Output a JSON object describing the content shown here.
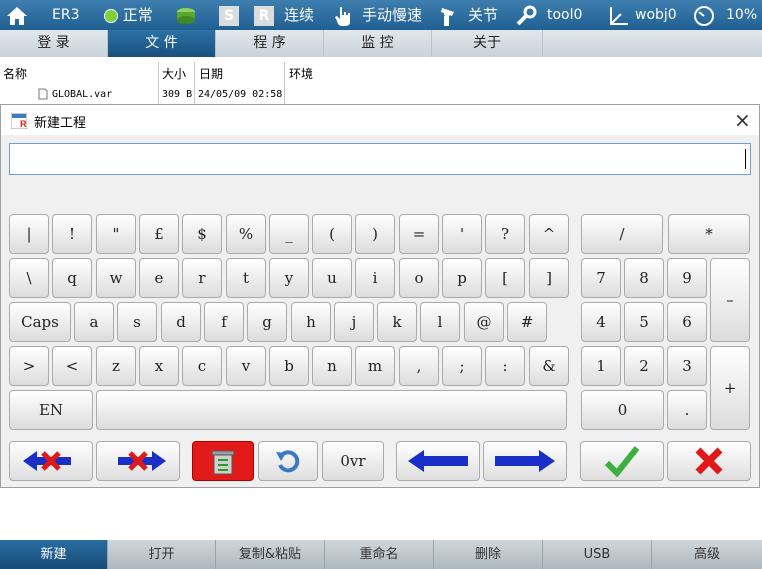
{
  "status_bar": {
    "robot": "ER3",
    "state": "正常",
    "mode_s": "S",
    "mode_r": "R",
    "run_mode": "连续",
    "speed_mode": "手动慢速",
    "coord": "关节",
    "tool": "tool0",
    "wobj": "wobj0",
    "speed_pct": "10%"
  },
  "tabs": [
    "登 录",
    "文 件",
    "程 序",
    "监 控",
    "关于"
  ],
  "file_list": {
    "headers": [
      "名称",
      "大小",
      "日期",
      "环境"
    ],
    "rows": [
      {
        "name": "GLOBAL.var",
        "size": "309 B",
        "date": "24/05/09 02:58",
        "env": ""
      }
    ]
  },
  "dialog": {
    "title": "新建工程",
    "close": "×",
    "input_value": ""
  },
  "keyboard": {
    "row1": [
      "|",
      "!",
      "\"",
      "£",
      "$",
      "%",
      "_",
      "(",
      ")",
      "=",
      "'",
      "?",
      "^"
    ],
    "row2": [
      "\\",
      "q",
      "w",
      "e",
      "r",
      "t",
      "y",
      "u",
      "i",
      "o",
      "p",
      "[",
      "]"
    ],
    "row3": [
      "Caps",
      "a",
      "s",
      "d",
      "f",
      "g",
      "h",
      "j",
      "k",
      "l",
      "@",
      "#"
    ],
    "row4": [
      ">",
      "<",
      "z",
      "x",
      "c",
      "v",
      "b",
      "n",
      "m",
      ",",
      ";",
      ":",
      "&"
    ],
    "lang": "EN",
    "space": "",
    "numpad": {
      "slash": "/",
      "star": "*",
      "minus": "–",
      "plus": "+",
      "zero": "0",
      "dot": ".",
      "r1": [
        "7",
        "8",
        "9"
      ],
      "r2": [
        "4",
        "5",
        "6"
      ],
      "r3": [
        "1",
        "2",
        "3"
      ]
    },
    "ovr": "0vr"
  },
  "bottom_bar": [
    "新建",
    "打开",
    "复制&粘贴",
    "重命名",
    "删除",
    "USB",
    "高级"
  ]
}
